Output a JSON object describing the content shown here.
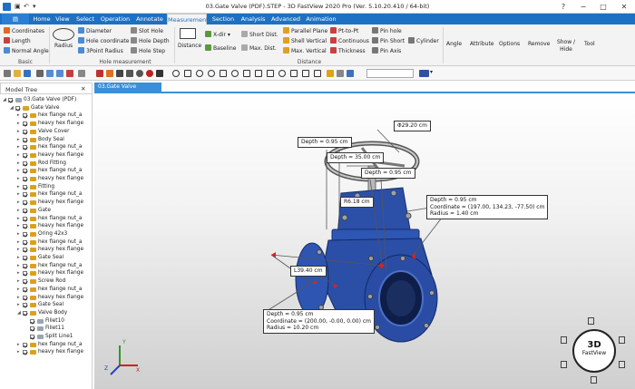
{
  "window": {
    "title": "03.Gate Valve (PDF).STEP - 3D FastView 2020 Pro (Ver. 5.10.20.410 / 64-bit)",
    "controls": [
      "?",
      "−",
      "□",
      "✕"
    ]
  },
  "menu_tabs": [
    "Home",
    "View",
    "Select",
    "Operation",
    "Annotate",
    "Measurement",
    "Section",
    "Analysis",
    "Advanced",
    "Animation"
  ],
  "active_tab": "Measurement",
  "ribbon": {
    "basic": {
      "items": [
        "Coordinates",
        "Length",
        "Normal Angle"
      ],
      "group_label": "Basic"
    },
    "radius": "Radius",
    "hole": {
      "items": [
        "Diameter",
        "Hole coordinate",
        "3Point Radius",
        "Slot Hole",
        "Hole Depth",
        "Hole Step"
      ],
      "group_label": "Hole measurement"
    },
    "distance": {
      "big": "Distance",
      "items": [
        "X-dir",
        "Baseline",
        "Short Dist.",
        "Max. Dist.",
        "Parallel Plane",
        "Shell Vertical",
        "Max. Vertical",
        "Pt-to-Pt",
        "Continuous",
        "Thickness",
        "Pin hole",
        "Pin Short",
        "Pin Axis",
        "Cylinder"
      ],
      "group_label": "Distance"
    },
    "right": [
      "Angle",
      "Attribute",
      "Options",
      "Remove",
      "Show / Hide",
      "Tool"
    ]
  },
  "model_tree": {
    "title": "Model Tree",
    "items": [
      {
        "label": "03.Gate Valve (PDF)",
        "level": 0,
        "type": "root"
      },
      {
        "label": "Gate Valve",
        "level": 1,
        "type": "asm"
      },
      {
        "label": "hex flange nut_a",
        "level": 2,
        "type": "part"
      },
      {
        "label": "heavy hex flange",
        "level": 2,
        "type": "part"
      },
      {
        "label": "Valve Cover",
        "level": 2,
        "type": "part"
      },
      {
        "label": "Body Seal",
        "level": 2,
        "type": "part"
      },
      {
        "label": "hex flange nut_a",
        "level": 2,
        "type": "part"
      },
      {
        "label": "heavy hex flange",
        "level": 2,
        "type": "part"
      },
      {
        "label": "Rod Fitting",
        "level": 2,
        "type": "part"
      },
      {
        "label": "hex flange nut_a",
        "level": 2,
        "type": "part"
      },
      {
        "label": "heavy hex flange",
        "level": 2,
        "type": "part"
      },
      {
        "label": "Fitting",
        "level": 2,
        "type": "part"
      },
      {
        "label": "hex flange nut_a",
        "level": 2,
        "type": "part"
      },
      {
        "label": "heavy hex flange",
        "level": 2,
        "type": "part"
      },
      {
        "label": "Gate",
        "level": 2,
        "type": "part"
      },
      {
        "label": "hex flange nut_a",
        "level": 2,
        "type": "part"
      },
      {
        "label": "heavy hex flange",
        "level": 2,
        "type": "part"
      },
      {
        "label": "Oring 42x3",
        "level": 2,
        "type": "part"
      },
      {
        "label": "hex flange nut_a",
        "level": 2,
        "type": "part"
      },
      {
        "label": "heavy hex flange",
        "level": 2,
        "type": "part"
      },
      {
        "label": "Gate Seal",
        "level": 2,
        "type": "part"
      },
      {
        "label": "hex flange nut_a",
        "level": 2,
        "type": "part"
      },
      {
        "label": "heavy hex flange",
        "level": 2,
        "type": "part"
      },
      {
        "label": "Screw Rod",
        "level": 2,
        "type": "part"
      },
      {
        "label": "hex flange nut_a",
        "level": 2,
        "type": "part"
      },
      {
        "label": "heavy hex flange",
        "level": 2,
        "type": "part"
      },
      {
        "label": "Gate Seal",
        "level": 2,
        "type": "part"
      },
      {
        "label": "Valve Body",
        "level": 2,
        "type": "part"
      },
      {
        "label": "Fillet10",
        "level": 3,
        "type": "feature"
      },
      {
        "label": "Fillet11",
        "level": 3,
        "type": "feature"
      },
      {
        "label": "Split Line1",
        "level": 3,
        "type": "feature"
      },
      {
        "label": "hex flange nut_a",
        "level": 2,
        "type": "part"
      },
      {
        "label": "heavy hex flange",
        "level": 2,
        "type": "part"
      }
    ]
  },
  "document_tab": "03.Gate Valve (PDF).STEP",
  "annotations": {
    "diameter": "Φ29.20 cm",
    "depth_top": "Depth = 0.95 cm",
    "depth_mid": "Depth = 35.00 cm",
    "depth_right": "Depth = 0.95 cm",
    "radius_r": "R6.18 cm",
    "right_box": [
      "Depth = 0.95 cm",
      "Coordinate = (197.00, 134.23, -77.50) cm",
      "Radius = 1.40 cm"
    ],
    "length": "L39.40 cm",
    "bottom_box": [
      "Depth = 0.95 cm",
      "Coordinate = (200.00, -0.00, 0.00) cm",
      "Radius = 10.20 cm"
    ]
  },
  "view_cube": {
    "line1": "3D",
    "line2": "FastView"
  },
  "axes": {
    "x": "X",
    "y": "Y",
    "z": "Z"
  },
  "colors": {
    "accent": "#1e70c2",
    "valve": "#2c4fa8",
    "annotation_red": "#e02020"
  }
}
